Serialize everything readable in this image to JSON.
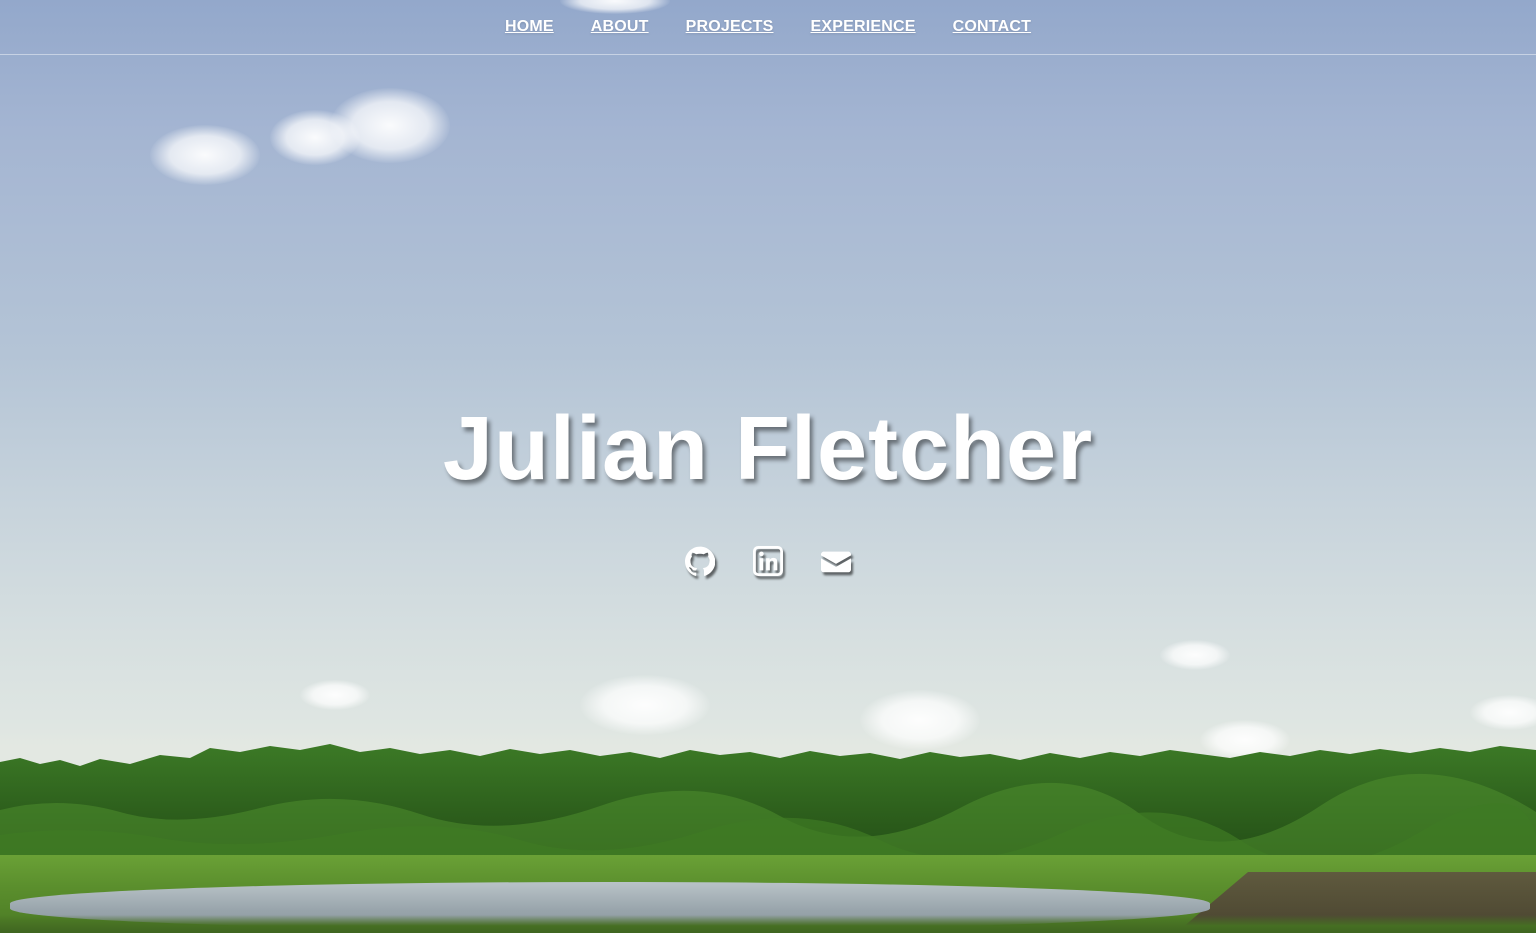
{
  "nav": {
    "items": [
      {
        "label": "HOME"
      },
      {
        "label": "ABOUT"
      },
      {
        "label": "PROJECTS"
      },
      {
        "label": "EXPERIENCE"
      },
      {
        "label": "CONTACT"
      }
    ]
  },
  "hero": {
    "name": "Julian Fletcher",
    "social_icons": [
      "github-icon",
      "linkedin-icon",
      "envelope-icon"
    ]
  },
  "colors": {
    "text": "#ffffff",
    "sky_top": "#93a8cb",
    "sky_horizon": "#e3e8e2",
    "foliage": "#2f5b1b"
  }
}
